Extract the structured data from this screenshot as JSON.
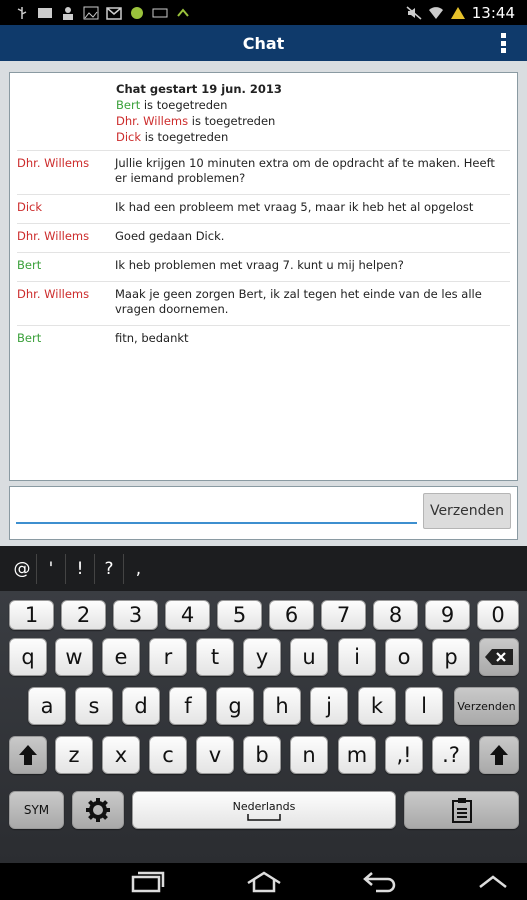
{
  "status_bar": {
    "time": "13:44"
  },
  "action_bar": {
    "title": "Chat"
  },
  "chat": {
    "started": "Chat gestart 19 jun. 2013",
    "joined": [
      {
        "name": "Bert",
        "color": "green",
        "text": "is toegetreden"
      },
      {
        "name": "Dhr. Willems",
        "color": "red",
        "text": " is toegetreden"
      },
      {
        "name": "Dick",
        "color": "red",
        "text": "is toegetreden"
      }
    ],
    "messages": [
      {
        "sender": "Dhr. Willems",
        "color": "red",
        "text": "Jullie krijgen 10 minuten extra om de opdracht af te maken. Heeft er iemand problemen?"
      },
      {
        "sender": "Dick",
        "color": "red",
        "text": "Ik had een probleem met vraag 5, maar ik heb het al opgelost"
      },
      {
        "sender": "Dhr. Willems",
        "color": "red",
        "text": "Goed gedaan Dick."
      },
      {
        "sender": "Bert",
        "color": "green",
        "text": "Ik heb problemen met vraag 7. kunt u mij helpen?"
      },
      {
        "sender": "Dhr. Willems",
        "color": "red",
        "text": "Maak je geen zorgen Bert, ik zal tegen het einde van de les alle vragen doornemen."
      },
      {
        "sender": "Bert",
        "color": "green",
        "text": "fitn, bedankt"
      }
    ]
  },
  "composer": {
    "input_value": "",
    "send_label": "Verzenden"
  },
  "keyboard": {
    "suggestions": [
      "@",
      "'",
      "!",
      "?",
      ","
    ],
    "row_numbers": [
      "1",
      "2",
      "3",
      "4",
      "5",
      "6",
      "7",
      "8",
      "9",
      "0"
    ],
    "row_q": [
      "q",
      "w",
      "e",
      "r",
      "t",
      "y",
      "u",
      "i",
      "o",
      "p"
    ],
    "row_a": [
      "a",
      "s",
      "d",
      "f",
      "g",
      "h",
      "j",
      "k",
      "l"
    ],
    "row_z": [
      "z",
      "x",
      "c",
      "v",
      "b",
      "n",
      "m",
      ",!",
      ".?"
    ],
    "enter_label": "Verzenden",
    "sym_label": "SYM",
    "space_label": "Nederlands",
    "icons": {
      "backspace": "backspace-icon",
      "shift": "shift-icon",
      "settings": "gear-icon",
      "clipboard": "clipboard-icon"
    }
  },
  "colors": {
    "action_bar": "#0f3a6b",
    "red": "#cc2b2b",
    "green": "#3aa03a",
    "input_underline": "#3d8fcf"
  }
}
